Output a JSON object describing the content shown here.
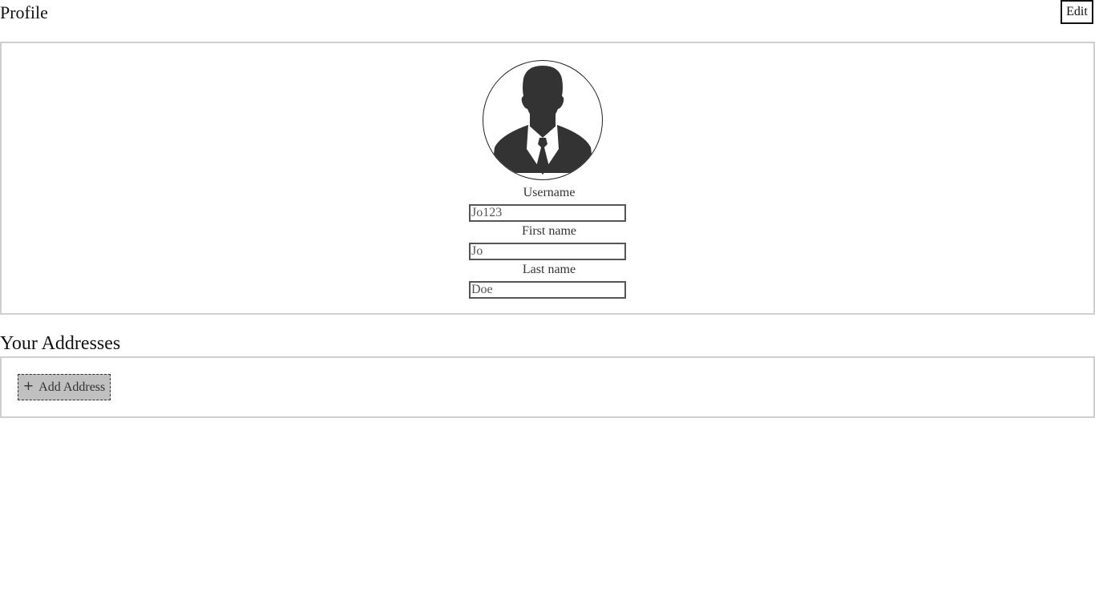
{
  "header": {
    "title": "Profile",
    "edit_label": "Edit"
  },
  "profile": {
    "avatar_icon": "user-silhouette-icon",
    "fields": [
      {
        "label": "Username",
        "value": "Jo123"
      },
      {
        "label": "First name",
        "value": "Jo"
      },
      {
        "label": "Last name",
        "value": "Doe"
      }
    ]
  },
  "addresses": {
    "title": "Your Addresses",
    "add_icon": "plus-icon",
    "add_label": "Add Address"
  }
}
